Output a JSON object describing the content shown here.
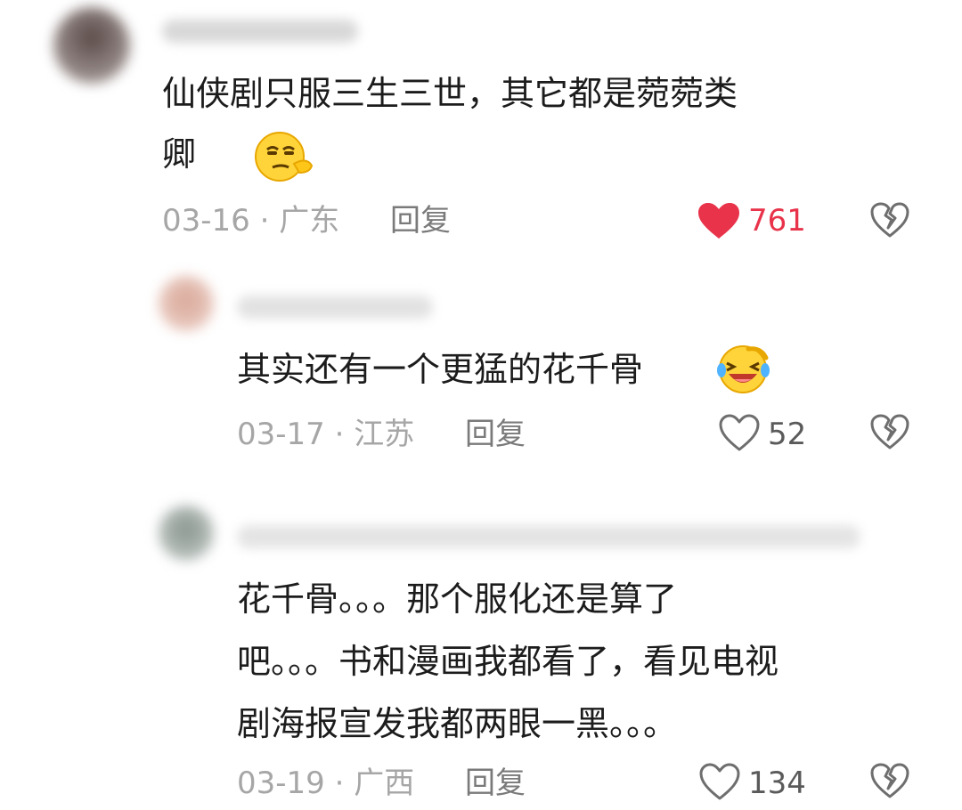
{
  "comments": [
    {
      "text_line1": "仙侠剧只服三生三世，其它都是菀菀类",
      "text_line2": "卿",
      "date": "03-16",
      "location": "广东",
      "reply_label": "回复",
      "likes": "761",
      "liked": true,
      "emoji": "smug-face"
    },
    {
      "text_line1": "其实还有一个更猛的花千骨",
      "date": "03-17",
      "location": "江苏",
      "reply_label": "回复",
      "likes": "52",
      "liked": false,
      "emoji": "laughing-tears-face"
    },
    {
      "text_line1": "花千骨。。。那个服化还是算了",
      "text_line2": "吧。。。书和漫画我都看了，看见电视",
      "text_line3": "剧海报宣发我都两眼一黑。。。",
      "date": "03-19",
      "location": "广西",
      "reply_label": "回复",
      "likes": "134",
      "liked": false
    }
  ],
  "separator": " · ",
  "colors": {
    "like_active": "#e8334a",
    "meta": "#a6a6a6"
  }
}
